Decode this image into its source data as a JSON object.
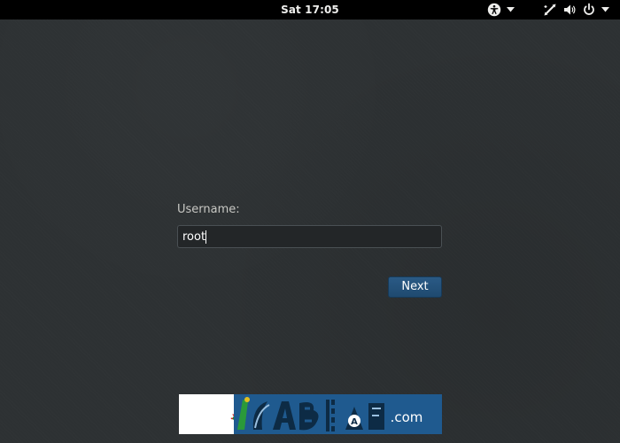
{
  "top_bar": {
    "clock": "Sat 17:05"
  },
  "icons": {
    "accessibility": "accessibility-icon",
    "network": "network-disconnected-icon",
    "volume": "volume-icon",
    "power": "power-icon",
    "dropdown": "chevron-down-icon"
  },
  "login": {
    "username_label": "Username:",
    "username_value": "root",
    "next_label": "Next"
  },
  "watermark": {
    "left_text": "آی تی ترفند",
    "domain_text": ".com"
  },
  "colors": {
    "background": "#2d3133",
    "top_bar": "#000000",
    "accent_button": "#245382",
    "watermark_blue": "#1f5a8f"
  }
}
